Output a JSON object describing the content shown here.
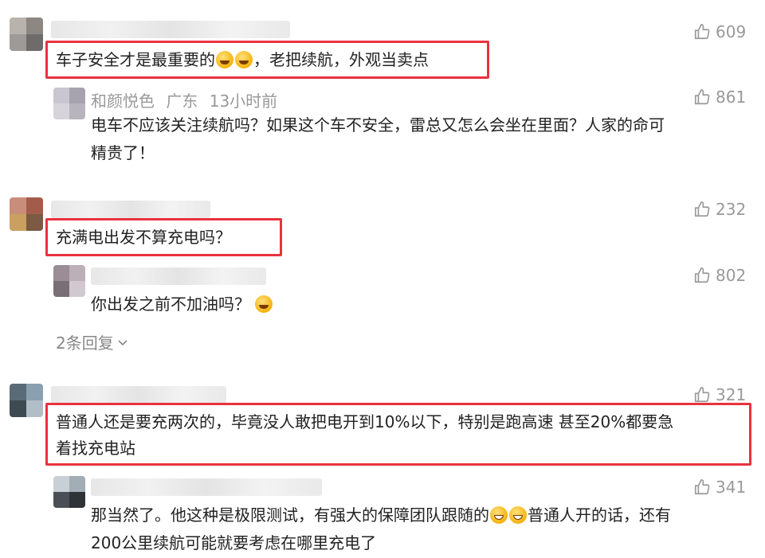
{
  "comments": [
    {
      "text": "车子安全才是最重要的",
      "text_after": "，老把续航，外观当卖点",
      "likes": "609"
    },
    {
      "name": "和颜悦色",
      "location": "广东",
      "time": "13小时前",
      "text": "电车不应该关注续航吗？如果这个车不安全，雷总又怎么会坐在里面？人家的命可",
      "text_line2": "精贵了！",
      "likes": "861"
    },
    {
      "text": "充满电出发不算充电吗？",
      "likes": "232"
    },
    {
      "text": "你出发之前不加油吗？",
      "likes": "802"
    },
    {
      "text": "普通人还是要充两次的，毕竟没人敢把电开到10%以下，特别是跑高速 甚至20%都要急",
      "text_line2": "着找充电站",
      "likes": "321"
    },
    {
      "text": "那当然了。他这种是极限测试，有强大的保障团队跟随的",
      "text_after": "普通人开的话，还有",
      "text_line2": "200公里续航可能就要考虑在哪里充电了",
      "likes": "341"
    }
  ],
  "more_replies": "2条回复",
  "icons": {
    "like": "thumbs-up-icon",
    "emoji_cry_laugh": "cry-laugh-emoji",
    "emoji_laugh": "laugh-emoji",
    "emoji_grin": "grin-emoji",
    "chevron": "chevron-down-icon"
  },
  "colors": {
    "highlight": "#e8323f",
    "muted": "#999999"
  }
}
